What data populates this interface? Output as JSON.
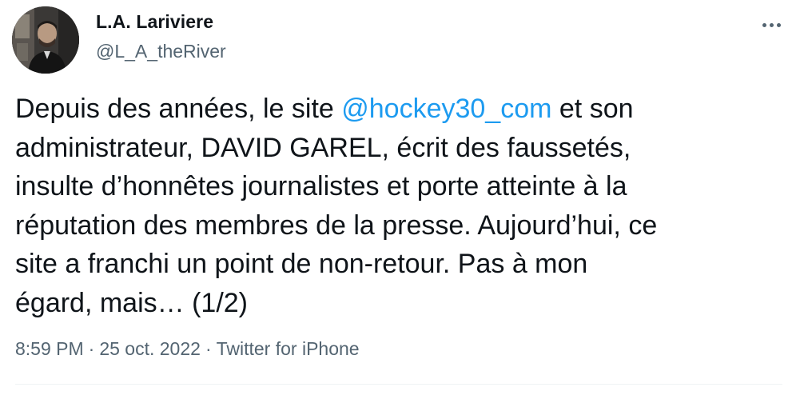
{
  "author": {
    "display_name": "L.A. Lariviere",
    "handle": "@L_A_theRiver",
    "avatar_icon": "user-avatar-photo"
  },
  "more_icon": "more-options-icon",
  "tweet": {
    "lines": [
      {
        "before": "Depuis des années, le site ",
        "mention": "@hockey30_com",
        "after": " et son"
      },
      {
        "text": "administrateur, DAVID GAREL, écrit des faussetés,"
      },
      {
        "text": "insulte d’honnêtes journalistes et porte atteinte à la"
      },
      {
        "text": "réputation des membres de la presse. Aujourd’hui, ce"
      },
      {
        "text": "site a franchi un point de non-retour. Pas à mon"
      },
      {
        "text": "égard, mais… (1/2)"
      }
    ]
  },
  "meta": {
    "time": "8:59 PM",
    "date": "25 oct. 2022",
    "source": "Twitter for iPhone",
    "separator": "·"
  },
  "colors": {
    "text": "#0f1419",
    "secondary": "#536471",
    "link": "#1d9bf0",
    "divider": "#eff3f4"
  }
}
